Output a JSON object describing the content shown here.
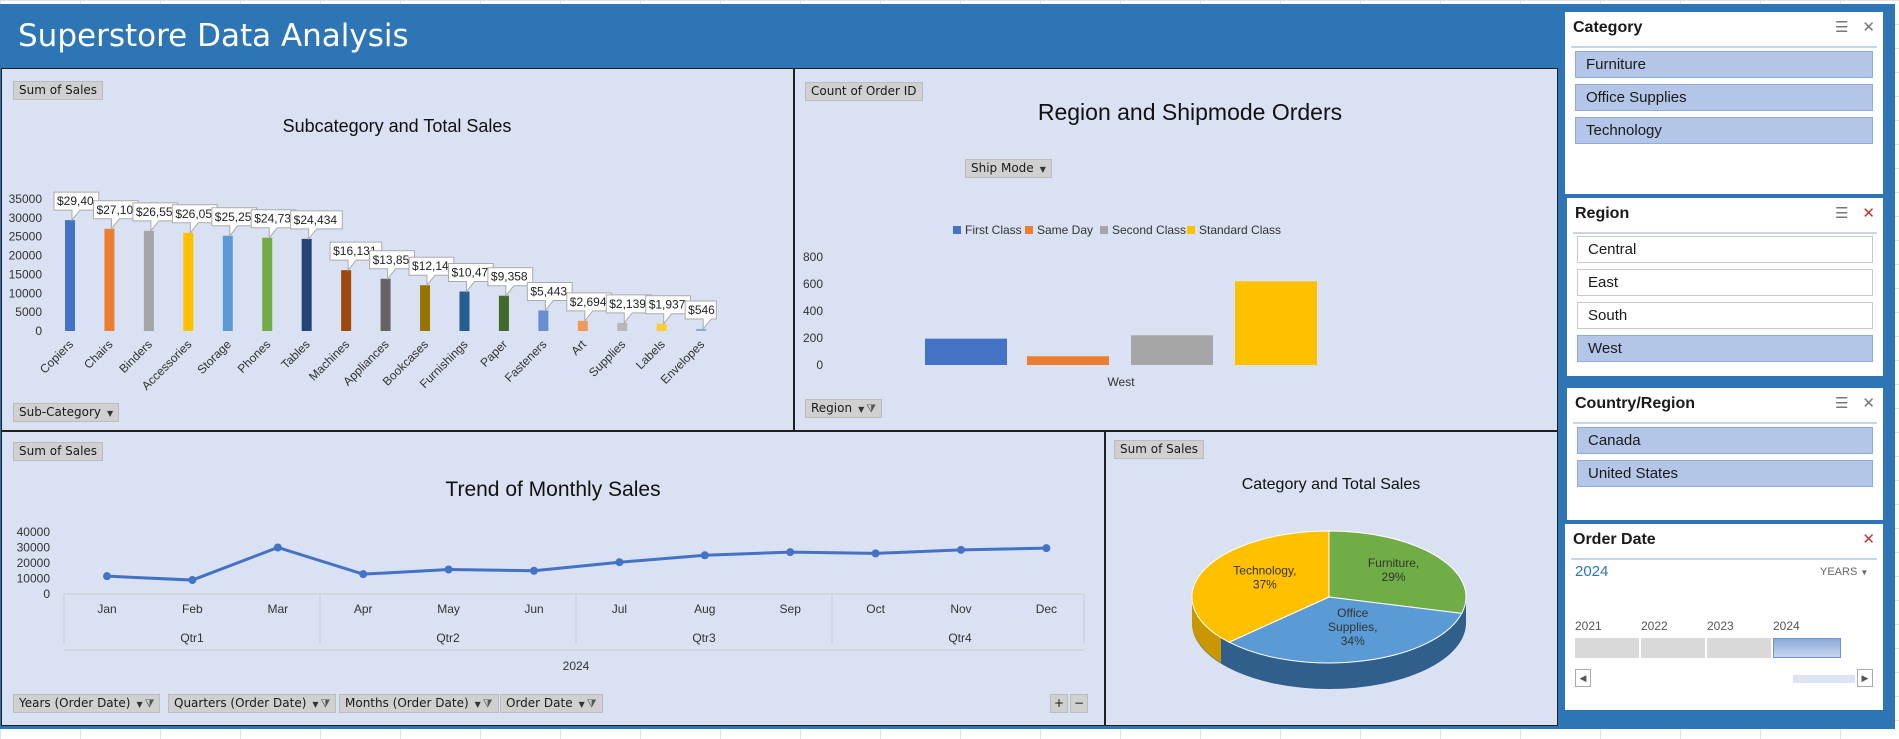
{
  "dashboard": {
    "title": "Superstore Data Analysis"
  },
  "subcategory_panel": {
    "value_button": "Sum of Sales",
    "axis_button": "Sub-Category",
    "title": "Subcategory and Total Sales"
  },
  "region_panel": {
    "value_button": "Count of Order ID",
    "legend_button": "Ship Mode",
    "axis_button": "Region",
    "title": "Region and Shipmode Orders"
  },
  "trend_panel": {
    "value_button": "Sum of Sales",
    "title": "Trend of Monthly Sales",
    "buttons": [
      "Years (Order Date)",
      "Quarters (Order Date)",
      "Months (Order Date)",
      "Order Date"
    ],
    "zoom_in": "+",
    "zoom_out": "−"
  },
  "category_panel": {
    "value_button": "Sum of Sales",
    "title": "Category and Total Sales"
  },
  "chart_data": [
    {
      "type": "bar",
      "title": "Subcategory and Total Sales",
      "xlabel": "",
      "ylabel": "",
      "ylim": [
        0,
        35000
      ],
      "yticks": [
        "0",
        "5000",
        "10000",
        "15000",
        "20000",
        "25000",
        "30000",
        "35000"
      ],
      "categories": [
        "Copiers",
        "Chairs",
        "Binders",
        "Accessories",
        "Storage",
        "Phones",
        "Tables",
        "Machines",
        "Appliances",
        "Bookcases",
        "Furnishings",
        "Paper",
        "Fasteners",
        "Art",
        "Supplies",
        "Labels",
        "Envelopes"
      ],
      "values": [
        29400,
        27100,
        26550,
        26050,
        25250,
        24730,
        24434,
        16131,
        13850,
        12140,
        10470,
        9358,
        5443,
        2694,
        2139,
        1937,
        546
      ],
      "data_labels": [
        "$29,40",
        "$27,10",
        "$26,55",
        "$26,05",
        "$25,25",
        "$24,73",
        "$24,434",
        "$16,131",
        "$13,85",
        "$12,14",
        "$10,47",
        "$9,358",
        "$5,443",
        "$2,694",
        "$2,139",
        "$1,937",
        "$546"
      ],
      "colors": [
        "#4472c4",
        "#ed7d31",
        "#a5a5a5",
        "#ffc000",
        "#5b9bd5",
        "#70ad47",
        "#264478",
        "#9e480e",
        "#636363",
        "#997300",
        "#255e91",
        "#43682b",
        "#698ed0",
        "#f1975a",
        "#b7b7b7",
        "#ffcd33",
        "#7cafdd"
      ]
    },
    {
      "type": "bar",
      "title": "Region and Shipmode Orders",
      "ylim": [
        0,
        800
      ],
      "yticks": [
        "0",
        "200",
        "400",
        "600",
        "800"
      ],
      "categories": [
        "West"
      ],
      "series": [
        {
          "name": "First Class",
          "values": [
            195
          ],
          "color": "#4472c4"
        },
        {
          "name": "Same Day",
          "values": [
            65
          ],
          "color": "#ed7d31"
        },
        {
          "name": "Second Class",
          "values": [
            220
          ],
          "color": "#a5a5a5"
        },
        {
          "name": "Standard Class",
          "values": [
            620
          ],
          "color": "#ffc000"
        }
      ],
      "legend": "top"
    },
    {
      "type": "line",
      "title": "Trend of Monthly Sales",
      "ylim": [
        0,
        40000
      ],
      "yticks": [
        "0",
        "10000",
        "20000",
        "30000",
        "40000"
      ],
      "x": [
        "Jan",
        "Feb",
        "Mar",
        "Apr",
        "May",
        "Jun",
        "Jul",
        "Aug",
        "Sep",
        "Oct",
        "Nov",
        "Dec"
      ],
      "quarters": [
        "Qtr1",
        "Qtr2",
        "Qtr3",
        "Qtr4"
      ],
      "year": "2024",
      "values": [
        11500,
        9000,
        30000,
        12800,
        15800,
        15000,
        20500,
        25000,
        27000,
        26200,
        28500,
        29600
      ],
      "color": "#4472c4"
    },
    {
      "type": "pie",
      "title": "Category and Total Sales",
      "slices": [
        {
          "label": "Furniture,",
          "pct_label": "29%",
          "value": 29,
          "color": "#70ad47"
        },
        {
          "label": "Office Supplies,",
          "pct_label": "34%",
          "value": 34,
          "color": "#5b9bd5"
        },
        {
          "label": "Technology,",
          "pct_label": "37%",
          "value": 37,
          "color": "#ffc000"
        }
      ]
    }
  ],
  "slicers": {
    "category": {
      "header": "Category",
      "items": [
        "Furniture",
        "Office Supplies",
        "Technology"
      ],
      "selected": [
        true,
        true,
        true
      ]
    },
    "region": {
      "header": "Region",
      "items": [
        "Central",
        "East",
        "South",
        "West"
      ],
      "selected": [
        false,
        false,
        false,
        true
      ]
    },
    "country": {
      "header": "Country/Region",
      "items": [
        "Canada",
        "United States"
      ],
      "selected": [
        true,
        true
      ]
    }
  },
  "timeline": {
    "header": "Order Date",
    "selected_year": "2024",
    "level": "YEARS",
    "years": [
      "2021",
      "2022",
      "2023",
      "2024"
    ],
    "selected_index": 3
  },
  "icons": {
    "multi_select": "☰",
    "clear_filter": "✕"
  }
}
